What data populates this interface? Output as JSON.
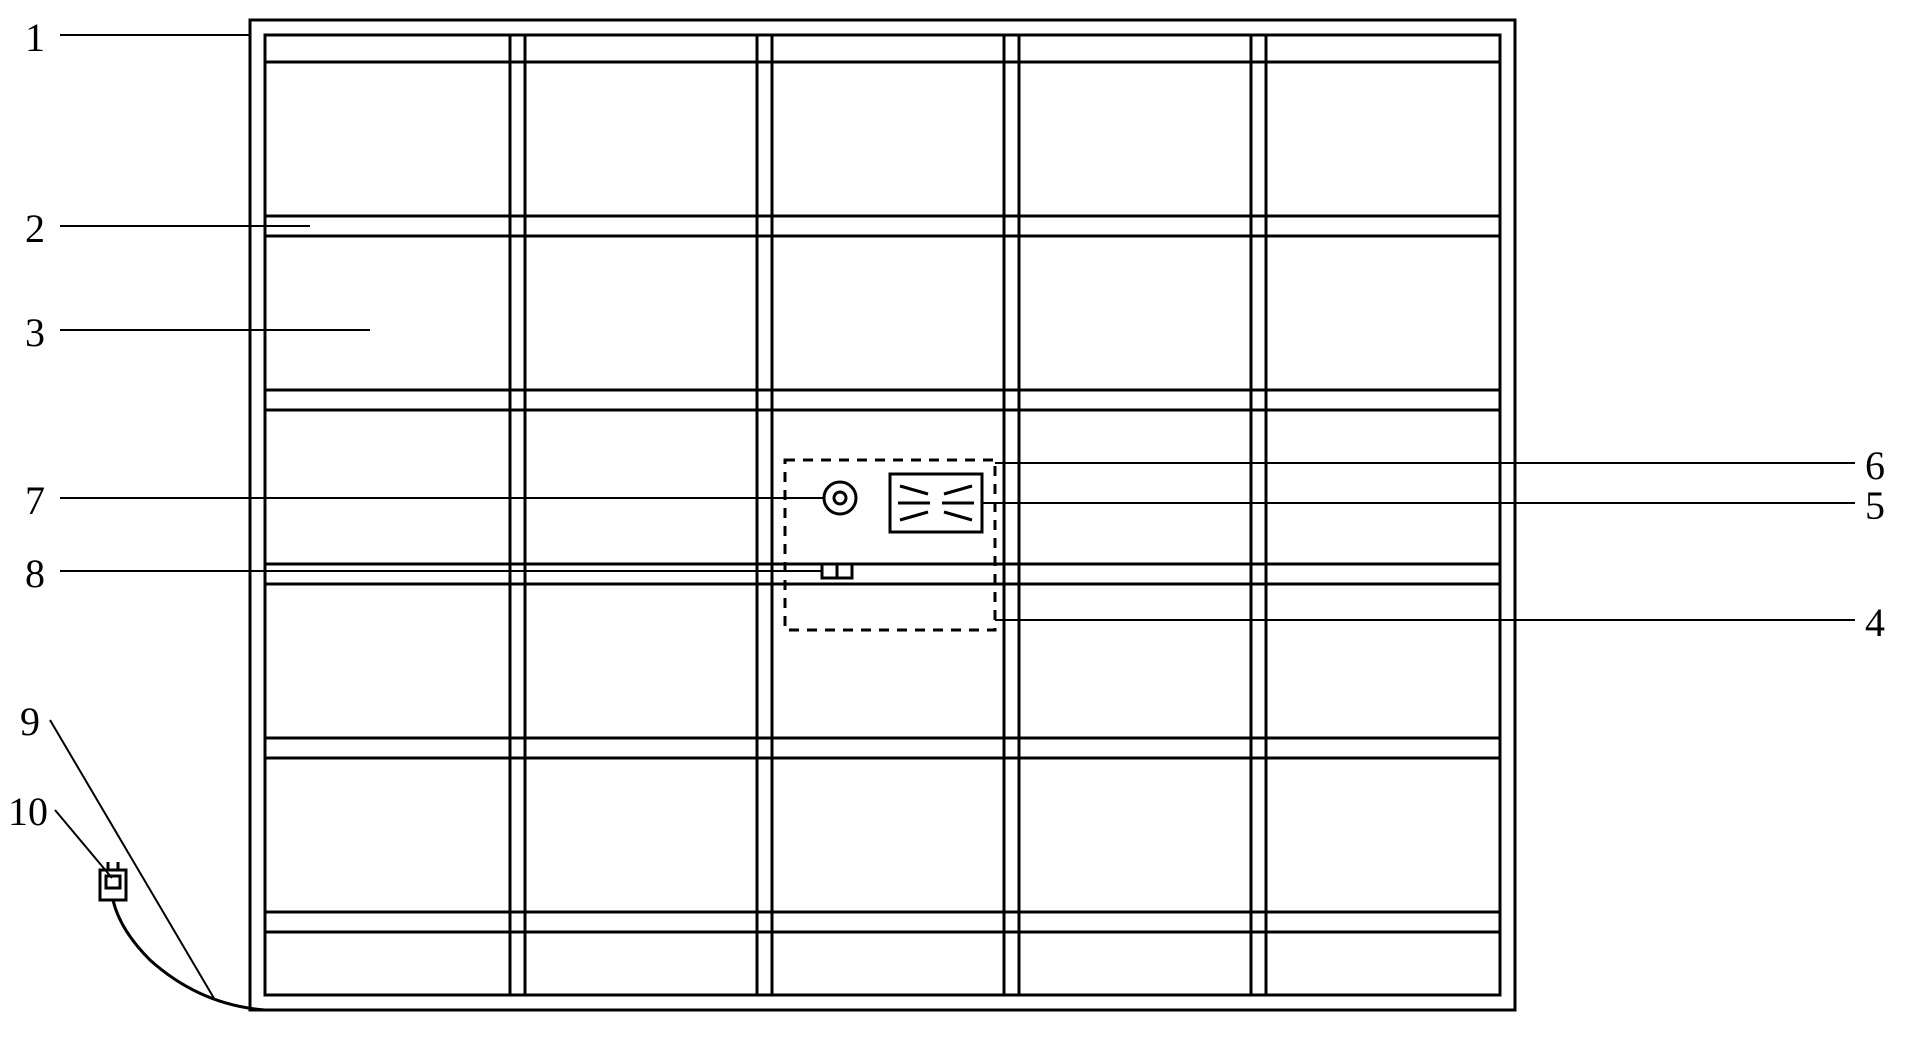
{
  "labels": {
    "p1": "1",
    "p2": "2",
    "p3": "3",
    "p4": "4",
    "p5": "5",
    "p6": "6",
    "p7": "7",
    "p8": "8",
    "p9": "9",
    "p10": "10"
  },
  "chart_data": {
    "type": "diagram",
    "description": "Technical line drawing of a modular grid structure (possibly a window, cabinet, or mat) with 5 columns and multiple rows, featuring a central control panel with circular dial, fan/vent element, and switch. External power cord with plug at bottom left.",
    "components": [
      {
        "ref": "1",
        "role": "outer frame / housing"
      },
      {
        "ref": "2",
        "role": "horizontal divider / slat"
      },
      {
        "ref": "3",
        "role": "panel / cell area"
      },
      {
        "ref": "4",
        "role": "control module boundary (dashed)"
      },
      {
        "ref": "5",
        "role": "fan / vent element"
      },
      {
        "ref": "6",
        "role": "upper edge of control module region"
      },
      {
        "ref": "7",
        "role": "circular dial / knob"
      },
      {
        "ref": "8",
        "role": "small switch / port"
      },
      {
        "ref": "9",
        "role": "power cable"
      },
      {
        "ref": "10",
        "role": "plug / connector"
      }
    ]
  }
}
